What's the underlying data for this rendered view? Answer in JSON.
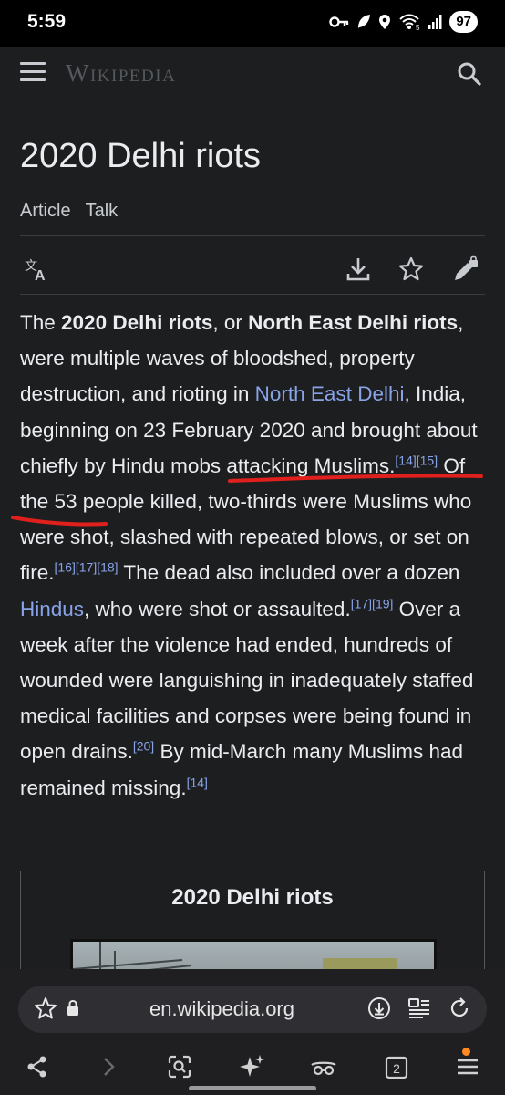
{
  "status": {
    "time": "5:59",
    "battery": "97",
    "signal_label": "5"
  },
  "header": {
    "wordmark": "Wikipedia"
  },
  "article": {
    "title": "2020 Delhi riots",
    "tabs": [
      {
        "label": "Article"
      },
      {
        "label": "Talk"
      }
    ]
  },
  "lead": {
    "p1": "The ",
    "b1": "2020 Delhi riots",
    "p2": ", or ",
    "b2": "North East Delhi riots",
    "p3": ", were multiple waves of bloodshed, property destruction, and rioting in ",
    "link1": "North East Delhi",
    "p4": ", India, beginning on 23 February 2020 and brought about chiefly by Hindu mobs attacking Muslims.",
    "ref1": "[14][15]",
    "p5": " Of the 53 people killed, two-thirds were Muslims who were shot, slashed with repeated blows, or set on fire.",
    "ref2": "[16][17][18]",
    "p6": " The dead also included over a dozen ",
    "link2": "Hindus",
    "p7": ", who were shot or assaulted.",
    "ref3": "[17][19]",
    "p8": " Over a week after the violence had ended, hundreds of wounded were languishing in inadequately staffed medical facilities and corpses were being found in open drains.",
    "ref4": "[20]",
    "p9": " By mid-March many Muslims had remained missing.",
    "ref5": "[14]"
  },
  "infobox": {
    "title": "2020 Delhi riots"
  },
  "browser": {
    "url": "en.wikipedia.org",
    "tab_count": "2"
  },
  "colors": {
    "link": "#88a3e8",
    "annotation": "#e0201c",
    "background": "#1d1e20"
  },
  "icons": [
    "key-icon",
    "leaf-icon",
    "location-icon",
    "wifi-icon",
    "signal-icon",
    "menu-icon",
    "search-icon",
    "translate-icon",
    "download-icon",
    "star-icon",
    "edit-lock-icon",
    "lock-icon",
    "download-circle-icon",
    "reader-icon",
    "reload-icon",
    "share-icon",
    "forward-icon",
    "lens-icon",
    "sparkle-icon",
    "incognito-icon",
    "tabs-icon",
    "overflow-menu-icon"
  ]
}
